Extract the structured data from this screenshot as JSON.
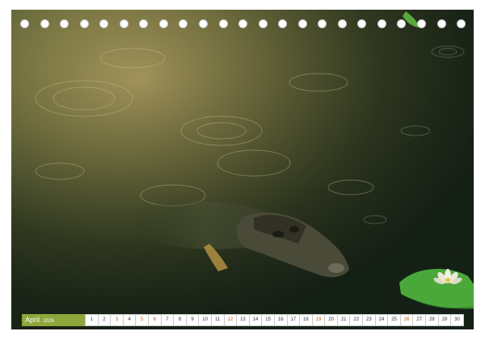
{
  "calendar": {
    "month": "April",
    "year": "2026",
    "days": [
      {
        "label": "1",
        "weekend": false
      },
      {
        "label": "2",
        "weekend": false
      },
      {
        "label": "3",
        "weekend": true
      },
      {
        "label": "4",
        "weekend": false
      },
      {
        "label": "5",
        "weekend": true
      },
      {
        "label": "6",
        "weekend": true
      },
      {
        "label": "7",
        "weekend": false
      },
      {
        "label": "8",
        "weekend": false
      },
      {
        "label": "9",
        "weekend": false
      },
      {
        "label": "10",
        "weekend": false
      },
      {
        "label": "11",
        "weekend": false
      },
      {
        "label": "12",
        "weekend": true
      },
      {
        "label": "13",
        "weekend": false
      },
      {
        "label": "14",
        "weekend": false
      },
      {
        "label": "15",
        "weekend": false
      },
      {
        "label": "16",
        "weekend": false
      },
      {
        "label": "17",
        "weekend": false
      },
      {
        "label": "18",
        "weekend": false
      },
      {
        "label": "19",
        "weekend": true
      },
      {
        "label": "20",
        "weekend": false
      },
      {
        "label": "21",
        "weekend": false
      },
      {
        "label": "22",
        "weekend": false
      },
      {
        "label": "23",
        "weekend": false
      },
      {
        "label": "24",
        "weekend": false
      },
      {
        "label": "25",
        "weekend": false
      },
      {
        "label": "26",
        "weekend": true
      },
      {
        "label": "27",
        "weekend": false
      },
      {
        "label": "28",
        "weekend": false
      },
      {
        "label": "29",
        "weekend": false
      },
      {
        "label": "30",
        "weekend": false
      }
    ]
  },
  "colors": {
    "month_bar": "#8fa63a",
    "weekend_text": "#d2541e",
    "day_text": "#333333"
  },
  "photo": {
    "subject": "alligator-in-water",
    "accent": "water-lily"
  }
}
